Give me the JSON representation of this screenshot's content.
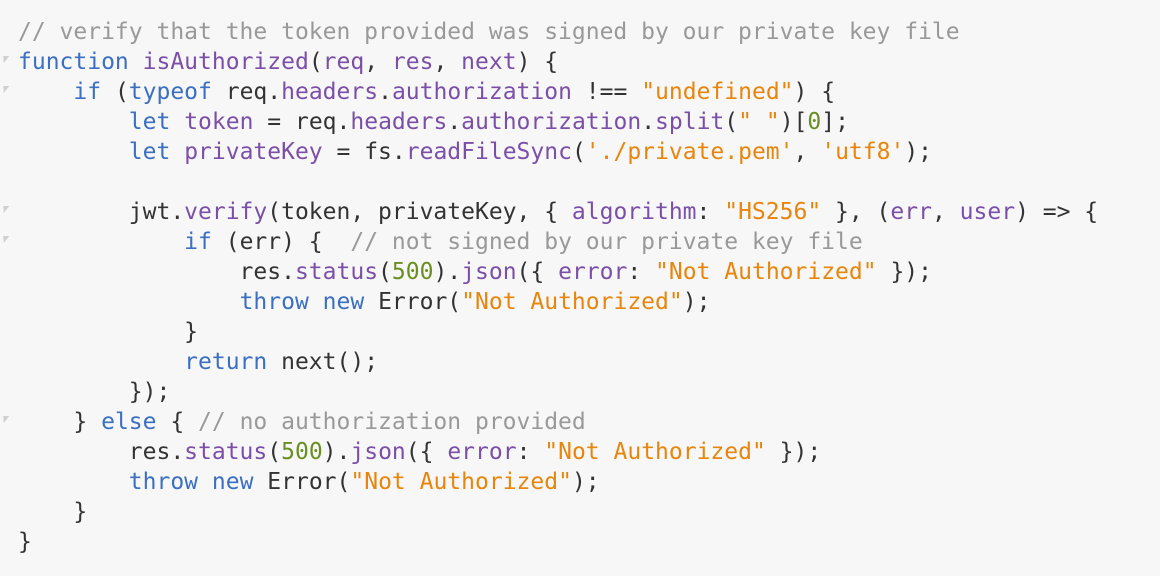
{
  "editor": {
    "colors": {
      "background": "#f7f7f7",
      "plain": "#333333",
      "comment": "#999999",
      "keyword": "#3b6fc2",
      "identifier": "#7b4fa8",
      "string": "#e8850c",
      "number": "#6b8e23",
      "fold": "#d0d0d0"
    },
    "lines": [
      {
        "fold": false,
        "tokens": [
          {
            "t": "c",
            "v": "// verify that the token provided was signed by our private key file"
          }
        ]
      },
      {
        "fold": true,
        "tokens": [
          {
            "t": "k",
            "v": "function"
          },
          {
            "t": "p",
            "v": " "
          },
          {
            "t": "i",
            "v": "isAuthorized"
          },
          {
            "t": "p",
            "v": "("
          },
          {
            "t": "i",
            "v": "req"
          },
          {
            "t": "p",
            "v": ", "
          },
          {
            "t": "i",
            "v": "res"
          },
          {
            "t": "p",
            "v": ", "
          },
          {
            "t": "i",
            "v": "next"
          },
          {
            "t": "p",
            "v": ") {"
          }
        ]
      },
      {
        "fold": true,
        "tokens": [
          {
            "t": "p",
            "v": "    "
          },
          {
            "t": "k",
            "v": "if"
          },
          {
            "t": "p",
            "v": " ("
          },
          {
            "t": "k",
            "v": "typeof"
          },
          {
            "t": "p",
            "v": " req."
          },
          {
            "t": "i",
            "v": "headers"
          },
          {
            "t": "p",
            "v": "."
          },
          {
            "t": "i",
            "v": "authorization"
          },
          {
            "t": "p",
            "v": " !== "
          },
          {
            "t": "s",
            "v": "\"undefined\""
          },
          {
            "t": "p",
            "v": ") {"
          }
        ]
      },
      {
        "fold": false,
        "tokens": [
          {
            "t": "p",
            "v": "        "
          },
          {
            "t": "k",
            "v": "let"
          },
          {
            "t": "p",
            "v": " "
          },
          {
            "t": "i",
            "v": "token"
          },
          {
            "t": "p",
            "v": " = req."
          },
          {
            "t": "i",
            "v": "headers"
          },
          {
            "t": "p",
            "v": "."
          },
          {
            "t": "i",
            "v": "authorization"
          },
          {
            "t": "p",
            "v": "."
          },
          {
            "t": "i",
            "v": "split"
          },
          {
            "t": "p",
            "v": "("
          },
          {
            "t": "s",
            "v": "\" \""
          },
          {
            "t": "p",
            "v": ")["
          },
          {
            "t": "n",
            "v": "0"
          },
          {
            "t": "p",
            "v": "];"
          }
        ]
      },
      {
        "fold": false,
        "tokens": [
          {
            "t": "p",
            "v": "        "
          },
          {
            "t": "k",
            "v": "let"
          },
          {
            "t": "p",
            "v": " "
          },
          {
            "t": "i",
            "v": "privateKey"
          },
          {
            "t": "p",
            "v": " = fs."
          },
          {
            "t": "i",
            "v": "readFileSync"
          },
          {
            "t": "p",
            "v": "("
          },
          {
            "t": "s",
            "v": "'./private.pem'"
          },
          {
            "t": "p",
            "v": ", "
          },
          {
            "t": "s",
            "v": "'utf8'"
          },
          {
            "t": "p",
            "v": ");"
          }
        ]
      },
      {
        "fold": false,
        "tokens": []
      },
      {
        "fold": true,
        "tokens": [
          {
            "t": "p",
            "v": "        jwt."
          },
          {
            "t": "i",
            "v": "verify"
          },
          {
            "t": "p",
            "v": "(token, privateKey, { "
          },
          {
            "t": "i",
            "v": "algorithm"
          },
          {
            "t": "p",
            "v": ": "
          },
          {
            "t": "s",
            "v": "\"HS256\""
          },
          {
            "t": "p",
            "v": " }, ("
          },
          {
            "t": "i",
            "v": "err"
          },
          {
            "t": "p",
            "v": ", "
          },
          {
            "t": "i",
            "v": "user"
          },
          {
            "t": "p",
            "v": ") => {"
          }
        ]
      },
      {
        "fold": true,
        "tokens": [
          {
            "t": "p",
            "v": "            "
          },
          {
            "t": "k",
            "v": "if"
          },
          {
            "t": "p",
            "v": " (err) {  "
          },
          {
            "t": "c",
            "v": "// not signed by our private key file"
          }
        ]
      },
      {
        "fold": false,
        "tokens": [
          {
            "t": "p",
            "v": "                res."
          },
          {
            "t": "i",
            "v": "status"
          },
          {
            "t": "p",
            "v": "("
          },
          {
            "t": "n",
            "v": "500"
          },
          {
            "t": "p",
            "v": ")."
          },
          {
            "t": "i",
            "v": "json"
          },
          {
            "t": "p",
            "v": "({ "
          },
          {
            "t": "i",
            "v": "error"
          },
          {
            "t": "p",
            "v": ": "
          },
          {
            "t": "s",
            "v": "\"Not Authorized\""
          },
          {
            "t": "p",
            "v": " });"
          }
        ]
      },
      {
        "fold": false,
        "tokens": [
          {
            "t": "p",
            "v": "                "
          },
          {
            "t": "k",
            "v": "throw"
          },
          {
            "t": "p",
            "v": " "
          },
          {
            "t": "k",
            "v": "new"
          },
          {
            "t": "p",
            "v": " Error("
          },
          {
            "t": "s",
            "v": "\"Not Authorized\""
          },
          {
            "t": "p",
            "v": ");"
          }
        ]
      },
      {
        "fold": false,
        "tokens": [
          {
            "t": "p",
            "v": "            }"
          }
        ]
      },
      {
        "fold": false,
        "tokens": [
          {
            "t": "p",
            "v": "            "
          },
          {
            "t": "k",
            "v": "return"
          },
          {
            "t": "p",
            "v": " next();"
          }
        ]
      },
      {
        "fold": false,
        "tokens": [
          {
            "t": "p",
            "v": "        });"
          }
        ]
      },
      {
        "fold": true,
        "tokens": [
          {
            "t": "p",
            "v": "    } "
          },
          {
            "t": "k",
            "v": "else"
          },
          {
            "t": "p",
            "v": " { "
          },
          {
            "t": "c",
            "v": "// no authorization provided"
          }
        ]
      },
      {
        "fold": false,
        "tokens": [
          {
            "t": "p",
            "v": "        res."
          },
          {
            "t": "i",
            "v": "status"
          },
          {
            "t": "p",
            "v": "("
          },
          {
            "t": "n",
            "v": "500"
          },
          {
            "t": "p",
            "v": ")."
          },
          {
            "t": "i",
            "v": "json"
          },
          {
            "t": "p",
            "v": "({ "
          },
          {
            "t": "i",
            "v": "error"
          },
          {
            "t": "p",
            "v": ": "
          },
          {
            "t": "s",
            "v": "\"Not Authorized\""
          },
          {
            "t": "p",
            "v": " });"
          }
        ]
      },
      {
        "fold": false,
        "tokens": [
          {
            "t": "p",
            "v": "        "
          },
          {
            "t": "k",
            "v": "throw"
          },
          {
            "t": "p",
            "v": " "
          },
          {
            "t": "k",
            "v": "new"
          },
          {
            "t": "p",
            "v": " Error("
          },
          {
            "t": "s",
            "v": "\"Not Authorized\""
          },
          {
            "t": "p",
            "v": ");"
          }
        ]
      },
      {
        "fold": false,
        "tokens": [
          {
            "t": "p",
            "v": "    }"
          }
        ]
      },
      {
        "fold": false,
        "tokens": [
          {
            "t": "p",
            "v": "}"
          }
        ]
      }
    ]
  }
}
